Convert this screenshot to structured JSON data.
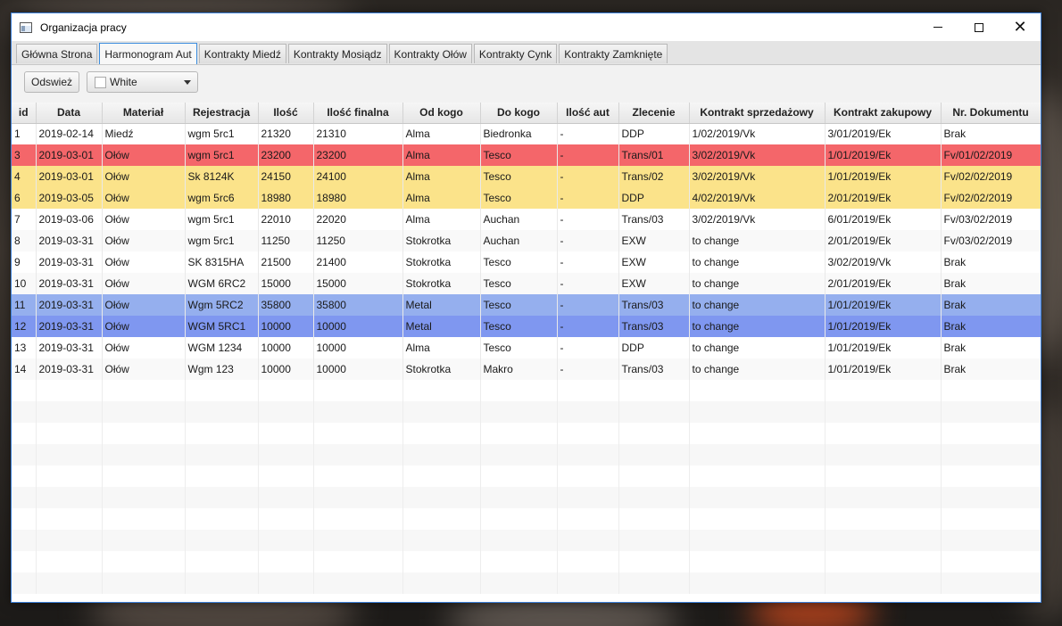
{
  "window": {
    "title": "Organizacja pracy",
    "controls": {
      "minimize": "minimize",
      "maximize": "maximize",
      "close": "✕"
    }
  },
  "tabs": [
    {
      "label": "Główna Strona",
      "active": false
    },
    {
      "label": "Harmonogram Aut",
      "active": true
    },
    {
      "label": "Kontrakty Miedź",
      "active": false
    },
    {
      "label": "Kontrakty Mosiądz",
      "active": false
    },
    {
      "label": "Kontrakty Ołów",
      "active": false
    },
    {
      "label": "Kontrakty Cynk",
      "active": false
    },
    {
      "label": "Kontrakty Zamknięte",
      "active": false
    }
  ],
  "toolbar": {
    "refresh_label": "Odswież",
    "color_select": {
      "value": "White",
      "swatch_color": "#ffffff"
    }
  },
  "row_colors": {
    "red": "#f4666a",
    "yellow": "#fbe38a",
    "blue1": "#95afee",
    "blue2": "#7f97f0"
  },
  "table": {
    "columns": [
      "id",
      "Data",
      "Materiał",
      "Rejestracja",
      "Ilość",
      "Ilość finalna",
      "Od kogo",
      "Do kogo",
      "Ilość aut",
      "Zlecenie",
      "Kontrakt sprzedażowy",
      "Kontrakt zakupowy",
      "Nr. Dokumentu"
    ],
    "rows": [
      {
        "highlight": "",
        "cells": [
          "1",
          "2019-02-14",
          "Miedź",
          "wgm 5rc1",
          "21320",
          "21310",
          "Alma",
          "Biedronka",
          "-",
          "DDP",
          "1/02/2019/Vk",
          "3/01/2019/Ek",
          "Brak"
        ]
      },
      {
        "highlight": "red",
        "cells": [
          "3",
          "2019-03-01",
          "Ołów",
          "wgm 5rc1",
          "23200",
          "23200",
          "Alma",
          "Tesco",
          "-",
          "Trans/01",
          "3/02/2019/Vk",
          "1/01/2019/Ek",
          "Fv/01/02/2019"
        ]
      },
      {
        "highlight": "yellow",
        "cells": [
          "4",
          "2019-03-01",
          "Ołów",
          "Sk 8124K",
          "24150",
          "24100",
          "Alma",
          "Tesco",
          "-",
          "Trans/02",
          "3/02/2019/Vk",
          "1/01/2019/Ek",
          "Fv/02/02/2019"
        ]
      },
      {
        "highlight": "yellow",
        "cells": [
          "6",
          "2019-03-05",
          "Ołów",
          "wgm 5rc6",
          "18980",
          "18980",
          "Alma",
          "Tesco",
          "-",
          "DDP",
          "4/02/2019/Vk",
          "2/01/2019/Ek",
          "Fv/02/02/2019"
        ]
      },
      {
        "highlight": "",
        "cells": [
          "7",
          "2019-03-06",
          "Ołów",
          "wgm 5rc1",
          "22010",
          "22020",
          "Alma",
          "Auchan",
          "-",
          "Trans/03",
          "3/02/2019/Vk",
          "6/01/2019/Ek",
          "Fv/03/02/2019"
        ]
      },
      {
        "highlight": "",
        "cells": [
          "8",
          "2019-03-31",
          "Ołów",
          "wgm 5rc1",
          "11250",
          "11250",
          "Stokrotka",
          "Auchan",
          "-",
          "EXW",
          "to change",
          "2/01/2019/Ek",
          "Fv/03/02/2019"
        ]
      },
      {
        "highlight": "",
        "cells": [
          "9",
          "2019-03-31",
          "Ołów",
          "SK 8315HA",
          "21500",
          "21400",
          "Stokrotka",
          "Tesco",
          "-",
          "EXW",
          "to change",
          "3/02/2019/Vk",
          "Brak"
        ]
      },
      {
        "highlight": "",
        "cells": [
          "10",
          "2019-03-31",
          "Ołów",
          "WGM 6RC2",
          "15000",
          "15000",
          "Stokrotka",
          "Tesco",
          "-",
          "EXW",
          "to change",
          "2/01/2019/Ek",
          "Brak"
        ]
      },
      {
        "highlight": "blue1",
        "cells": [
          "11",
          "2019-03-31",
          "Ołów",
          "Wgm 5RC2",
          "35800",
          "35800",
          "Metal",
          "Tesco",
          "-",
          "Trans/03",
          "to change",
          "1/01/2019/Ek",
          "Brak"
        ]
      },
      {
        "highlight": "blue2",
        "cells": [
          "12",
          "2019-03-31",
          "Ołów",
          "WGM 5RC1",
          "10000",
          "10000",
          "Metal",
          "Tesco",
          "-",
          "Trans/03",
          "to change",
          "1/01/2019/Ek",
          "Brak"
        ]
      },
      {
        "highlight": "",
        "cells": [
          "13",
          "2019-03-31",
          "Ołów",
          "WGM 1234",
          "10000",
          "10000",
          "Alma",
          "Tesco",
          "-",
          "DDP",
          "to change",
          "1/01/2019/Ek",
          "Brak"
        ]
      },
      {
        "highlight": "",
        "cells": [
          "14",
          "2019-03-31",
          "Ołów",
          "Wgm 123",
          "10000",
          "10000",
          "Stokrotka",
          "Makro",
          "-",
          "Trans/03",
          "to change",
          "1/01/2019/Ek",
          "Brak"
        ]
      }
    ]
  }
}
